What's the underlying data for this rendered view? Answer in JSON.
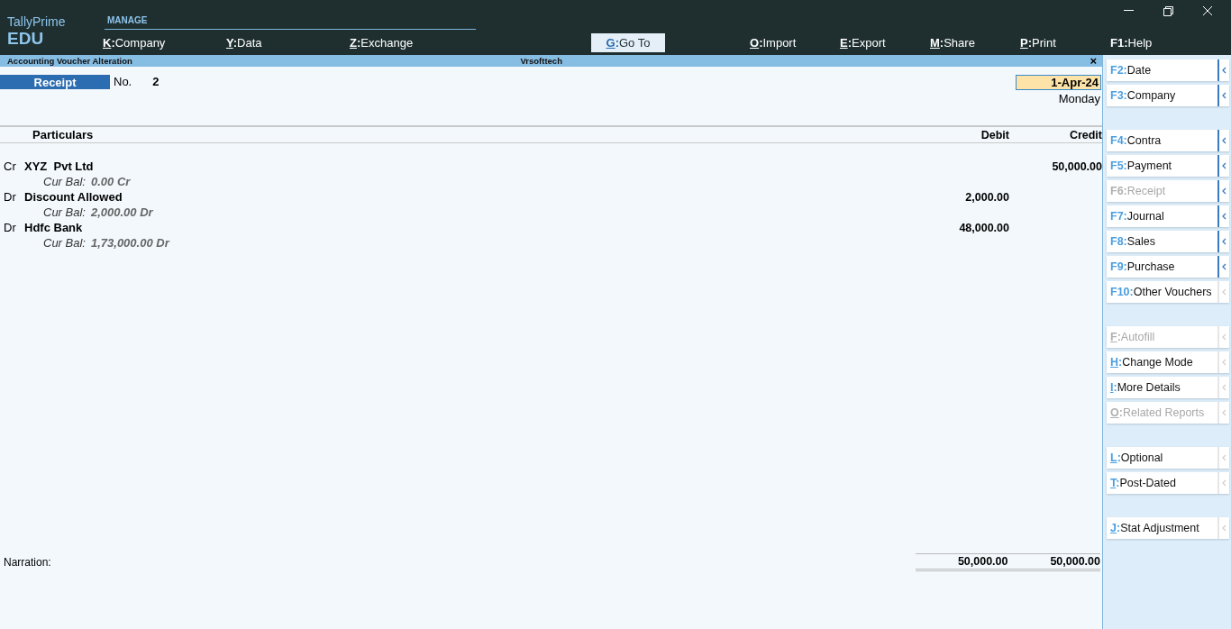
{
  "app": {
    "name": "TallyPrime",
    "edition": "EDU"
  },
  "menu_group": {
    "label": "MANAGE"
  },
  "top_menu": [
    {
      "key": "K:",
      "underline": true,
      "label": "Company",
      "selected": false
    },
    {
      "key": "Y:",
      "underline": true,
      "label": "Data",
      "selected": false
    },
    {
      "key": "Z:",
      "underline": true,
      "label": "Exchange",
      "selected": false
    },
    {
      "key": "G:",
      "underline": true,
      "label": "Go To",
      "selected": true
    },
    {
      "key": "O:",
      "underline": true,
      "label": "Import",
      "selected": false
    },
    {
      "key": "E:",
      "underline": true,
      "label": "Export",
      "selected": false
    },
    {
      "key": "M:",
      "underline": true,
      "label": "Share",
      "selected": false
    },
    {
      "key": "P:",
      "underline": true,
      "label": "Print",
      "selected": false
    },
    {
      "key": "F1:",
      "underline": false,
      "label": "Help",
      "selected": false
    }
  ],
  "title_bar": {
    "screen": "Accounting Voucher Alteration",
    "company": "Vrsofttech",
    "close": "×"
  },
  "voucher": {
    "type": "Receipt",
    "no_label": "No.",
    "number": "2",
    "date": "1-Apr-24",
    "day": "Monday"
  },
  "columns": {
    "particulars": "Particulars",
    "debit": "Debit",
    "credit": "Credit"
  },
  "entries": [
    {
      "dr_cr": "Cr",
      "ledger": "XYZ  Pvt Ltd",
      "balance_label": "Cur Bal:",
      "balance": "0.00 Cr",
      "credit": "50,000.00"
    },
    {
      "dr_cr": "Dr",
      "ledger": "Discount Allowed",
      "balance_label": "Cur Bal:",
      "balance": "2,000.00 Dr",
      "debit": "2,000.00"
    },
    {
      "dr_cr": "Dr",
      "ledger": "Hdfc Bank",
      "balance_label": "Cur Bal:",
      "balance": "1,73,000.00 Dr",
      "debit": "48,000.00"
    }
  ],
  "narration_label": "Narration:",
  "totals": {
    "debit": "50,000.00",
    "credit": "50,000.00"
  },
  "side_panel": [
    [
      {
        "key": "F2:",
        "underline": false,
        "label": "Date",
        "disabled": false,
        "submenu": true
      },
      {
        "key": "F3:",
        "underline": false,
        "label": "Company",
        "disabled": false,
        "submenu": true
      }
    ],
    [
      {
        "key": "F4:",
        "underline": false,
        "label": "Contra",
        "disabled": false,
        "submenu": true
      },
      {
        "key": "F5:",
        "underline": false,
        "label": "Payment",
        "disabled": false,
        "submenu": true
      },
      {
        "key": "F6:",
        "underline": false,
        "label": "Receipt",
        "disabled": true,
        "submenu": true
      },
      {
        "key": "F7:",
        "underline": false,
        "label": "Journal",
        "disabled": false,
        "submenu": true
      },
      {
        "key": "F8:",
        "underline": false,
        "label": "Sales",
        "disabled": false,
        "submenu": true
      },
      {
        "key": "F9:",
        "underline": false,
        "label": "Purchase",
        "disabled": false,
        "submenu": true
      },
      {
        "key": "F10:",
        "underline": false,
        "label": "Other Vouchers",
        "disabled": false,
        "submenu": false
      }
    ],
    [
      {
        "key": "F:",
        "underline": true,
        "label": "Autofill",
        "disabled": true,
        "submenu": false
      },
      {
        "key": "H:",
        "underline": true,
        "label": "Change Mode",
        "disabled": false,
        "submenu": false
      },
      {
        "key": "I:",
        "underline": true,
        "label": "More Details",
        "disabled": false,
        "submenu": false
      },
      {
        "key": "O:",
        "underline": true,
        "label": "Related Reports",
        "disabled": true,
        "submenu": false
      }
    ],
    [
      {
        "key": "L:",
        "underline": true,
        "label": "Optional",
        "disabled": false,
        "submenu": false
      },
      {
        "key": "T:",
        "underline": true,
        "label": "Post-Dated",
        "disabled": false,
        "submenu": false
      }
    ],
    [
      {
        "key": "J:",
        "underline": true,
        "label": "Stat Adjustment",
        "disabled": false,
        "submenu": false
      }
    ]
  ]
}
